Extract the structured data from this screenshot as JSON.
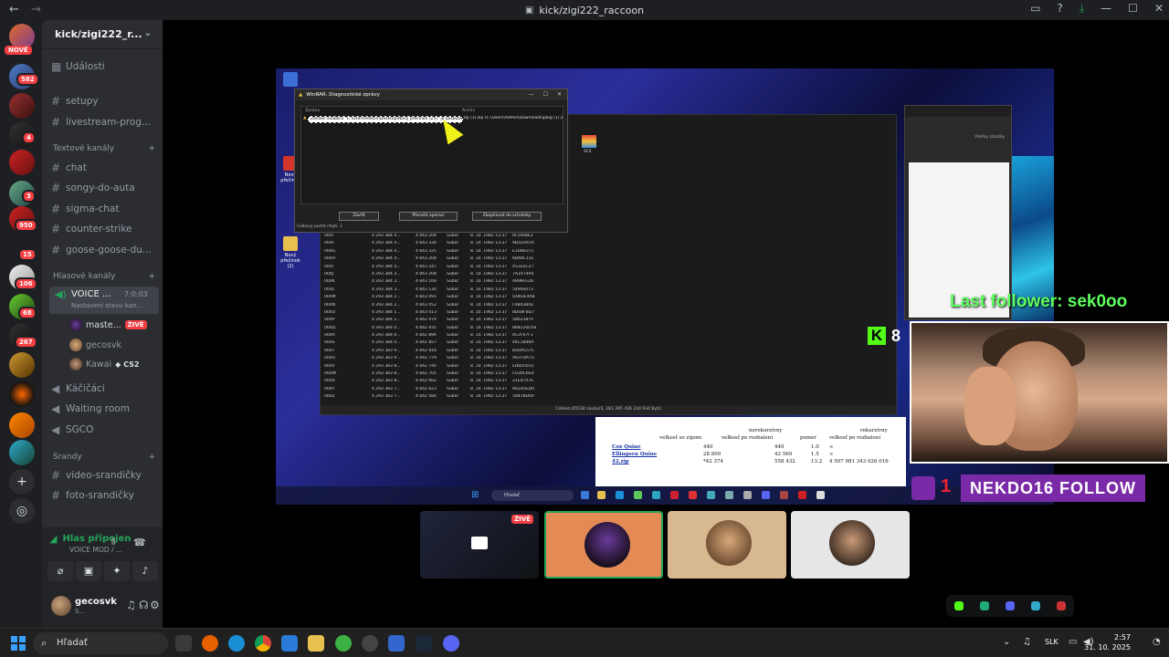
{
  "window": {
    "title": "kick/zigi222_raccoon",
    "back": "←",
    "forward": "→"
  },
  "guilds": {
    "new_badge": "NOVÉ",
    "badges": [
      "582",
      "4",
      "3",
      "950",
      "15",
      "106",
      "68",
      "267"
    ]
  },
  "server": {
    "name": "kick/zigi222_r...",
    "events": "Události",
    "channels_top": [
      "setupy",
      "livestream-prog..."
    ],
    "text_category": "Textové kanály",
    "text_channels": [
      "chat",
      "songy-do-auta",
      "sigma-chat",
      "counter-strike",
      "goose-goose-du..."
    ],
    "voice_category": "Hlasové kanály",
    "voice_channel": {
      "name": "VOICE ...",
      "timer": "7:0:03",
      "status": "Nastaveni stavu kan..."
    },
    "voice_users": [
      {
        "name": "maste...",
        "badge": "ŽIVĚ"
      },
      {
        "name": "gecosvk",
        "badge": ""
      },
      {
        "name": "Kawai",
        "badge": "CS2"
      }
    ],
    "voice_channels_other": [
      "Káčičáci",
      "Waiting room",
      "SGCO"
    ],
    "srandy_category": "Srandy",
    "srandy_channels": [
      "video-srandičky",
      "foto-srandičky"
    ]
  },
  "voice_panel": {
    "status": "Hlas připojen",
    "sub": "VOICE MOD / ..."
  },
  "user_panel": {
    "name": "gecosvk",
    "status": "S..."
  },
  "stream": {
    "winrar": {
      "title": "WinRAR: Diagnostické zprávy",
      "col_message": "Zpráva",
      "col_archive": "Archiv",
      "row_message": "Záhlaví souboru \"C:\\Users\\Admin\\Desktop\\Nový přečinok (2)\\\\\" je poškozeno",
      "row_archive": "zip (1).zip (C:\\Users\\Admin\\Downloads\\pbig (1).zip)",
      "btn_close": "Zavřít",
      "btn_stop": "Přerušit operaci",
      "btn_copy": "Zkopírovat do schránky",
      "footer": "Celkový počet chyb: 1"
    },
    "explorer": {
      "sfx_label": "SFX",
      "status": "Celkem 65534 souborů, 281 395 436 244 934 Bytů",
      "rows": [
        [
          "000I",
          "4 293 384 4...",
          "4 843 204",
          "Súbor",
          "8. 10. 1982 13:37",
          "0F1008E2"
        ],
        [
          "000F",
          "4 293 384 4...",
          "4 843 334",
          "Súbor",
          "8. 10. 1982 13:37",
          "9D1E091A"
        ],
        [
          "000G",
          "4 293 384 4...",
          "4 843 325",
          "Súbor",
          "8. 10. 1982 13:37",
          "E1D803T1"
        ],
        [
          "000H",
          "4 293 384 4...",
          "4 843 208",
          "Súbor",
          "8. 10. 1982 13:37",
          "6B48C11E"
        ],
        [
          "000I",
          "4 293 384 4...",
          "4 843 247",
          "Súbor",
          "8. 10. 1982 13:37",
          "A5322C27"
        ],
        [
          "000J",
          "4 293 384 3...",
          "4 843 208",
          "Súbor",
          "8. 10. 1982 13:37",
          "7A1474A0"
        ],
        [
          "000K",
          "4 293 384 3...",
          "4 843 169",
          "Súbor",
          "8. 10. 1982 13:37",
          "A898FE28"
        ],
        [
          "000L",
          "4 293 384 3...",
          "4 843 130",
          "Súbor",
          "8. 10. 1982 13:37",
          "5490E073"
        ],
        [
          "000M",
          "4 293 384 2...",
          "4 843 091",
          "Súbor",
          "8. 10. 1982 13:37",
          "DDB3E4A8"
        ],
        [
          "000N",
          "4 293 384 2...",
          "4 843 052",
          "Súbor",
          "8. 10. 1982 13:37",
          "F0B43BA2"
        ],
        [
          "000O",
          "4 293 384 1...",
          "4 843 013",
          "Súbor",
          "8. 10. 1982 13:37",
          "8D08FBD7"
        ],
        [
          "000P",
          "4 293 384 1...",
          "4 842 974",
          "Súbor",
          "8. 10. 1982 13:37",
          "5B6238TA"
        ],
        [
          "000Q",
          "4 293 384 0...",
          "4 842 935",
          "Súbor",
          "8. 10. 1982 13:37",
          "868120D56"
        ],
        [
          "000R",
          "4 293 384 0...",
          "4 842 896",
          "Súbor",
          "8. 10. 1982 13:37",
          "0C2F67F1"
        ],
        [
          "000S",
          "4 293 384 0...",
          "4 842 857",
          "Súbor",
          "8. 10. 1982 13:37",
          "44C1846A"
        ],
        [
          "000T",
          "4 293 383 9...",
          "4 842 818",
          "Súbor",
          "8. 10. 1982 13:37",
          "B2DA157C"
        ],
        [
          "000U",
          "4 293 383 9...",
          "4 842 779",
          "Súbor",
          "8. 10. 1982 13:37",
          "A637DA75"
        ],
        [
          "000V",
          "4 293 383 8...",
          "4 842 740",
          "Súbor",
          "8. 10. 1982 13:37",
          "ED605015"
        ],
        [
          "000W",
          "4 293 383 8...",
          "4 842 701",
          "Súbor",
          "8. 10. 1982 13:37",
          "C030C6E0"
        ],
        [
          "000X",
          "4 293 383 8...",
          "4 842 662",
          "Súbor",
          "8. 10. 1982 13:37",
          "21E47A7E"
        ],
        [
          "000Y",
          "4 293 383 7...",
          "4 842 623",
          "Súbor",
          "8. 10. 1982 13:37",
          "662D5ED0"
        ],
        [
          "000Z",
          "4 293 383 7...",
          "4 842 584",
          "Súbor",
          "8. 10. 1982 13:37",
          "5087BD00"
        ]
      ]
    },
    "desktop_label": "Nový přečinok (2)",
    "desktop_label2": "Nový přečinok",
    "browser_bookmarks": "Všetky záložky",
    "paper": {
      "col1": "veľkosť so zipom",
      "col2a": "nerekurzívny",
      "col2": "veľkosť po rozbalení",
      "col3": "pomer",
      "col4a": "rekurzívny",
      "col4": "veľkosť po rozbalení",
      "rows": [
        {
          "name": "Cox Quine",
          "a": "440",
          "b": "440",
          "c": "1.0",
          "d": "∞"
        },
        {
          "name": "Ellingsen Quine",
          "a": "28 809",
          "b": "42 569",
          "c": "1.5",
          "d": "∞"
        },
        {
          "name": "42.zip",
          "a": "*42 374",
          "b": "558 432",
          "c": "13.2",
          "d": "4 507 981 343 026 016"
        }
      ]
    },
    "taskbar_search": "Hľadať"
  },
  "overlays": {
    "last_follower": "Last follower: sek0oo",
    "kick_letter": "K",
    "kick_count": "8",
    "follow_banner": "NEKDO16 FOLLOW",
    "follow_num": "1"
  },
  "tiles": {
    "live_badge": "ŽIVĚ"
  },
  "taskbar": {
    "search": "Hľadať",
    "lang": "SLK",
    "time": "2:57",
    "date": "31. 10. 2025"
  }
}
